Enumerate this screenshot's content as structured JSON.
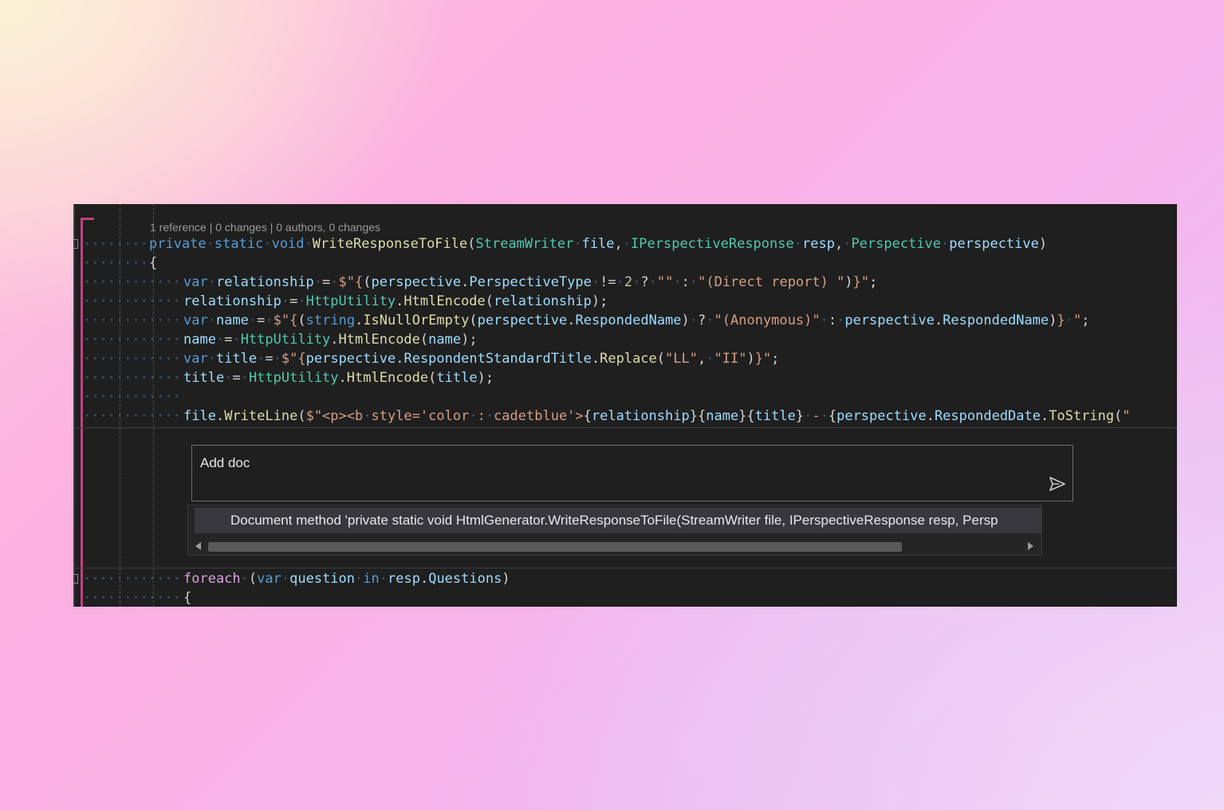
{
  "codelens": "1 reference | 0 changes | 0 authors, 0 changes",
  "code_lines": [
    {
      "tokens": [
        [
          "kw",
          "private"
        ],
        [
          "ws",
          " "
        ],
        [
          "kw",
          "static"
        ],
        [
          "ws",
          " "
        ],
        [
          "kw",
          "void"
        ],
        [
          "ws",
          " "
        ],
        [
          "mt",
          "WriteResponseToFile"
        ],
        [
          "",
          "("
        ],
        [
          "ty",
          "StreamWriter"
        ],
        [
          "ws",
          " "
        ],
        [
          "vr",
          "file"
        ],
        [
          "",
          ","
        ],
        [
          "ws",
          " "
        ],
        [
          "ty",
          "IPerspectiveResponse"
        ],
        [
          "ws",
          " "
        ],
        [
          "vr",
          "resp"
        ],
        [
          "",
          ","
        ],
        [
          "ws",
          " "
        ],
        [
          "ty",
          "Perspective"
        ],
        [
          "ws",
          " "
        ],
        [
          "vr",
          "perspective"
        ],
        [
          "",
          ")"
        ]
      ]
    },
    {
      "tokens": [
        [
          "",
          "{"
        ]
      ]
    },
    {
      "tokens": [
        [
          "kw",
          "var"
        ],
        [
          "ws",
          " "
        ],
        [
          "vr",
          "relationship"
        ],
        [
          "ws",
          " "
        ],
        [
          "",
          "="
        ],
        [
          "ws",
          " "
        ],
        [
          "st",
          "$\"{"
        ],
        [
          "",
          "("
        ],
        [
          "vr",
          "perspective"
        ],
        [
          "",
          "."
        ],
        [
          "vr",
          "PerspectiveType"
        ],
        [
          "ws",
          " "
        ],
        [
          "",
          "!="
        ],
        [
          "ws",
          " "
        ],
        [
          "nm",
          "2"
        ],
        [
          "ws",
          " "
        ],
        [
          "",
          "?"
        ],
        [
          "ws",
          " "
        ],
        [
          "st",
          "\"\""
        ],
        [
          "ws",
          " "
        ],
        [
          "",
          ":"
        ],
        [
          "ws",
          " "
        ],
        [
          "st",
          "\"(Direct report) \""
        ],
        [
          "",
          ")"
        ],
        [
          "st",
          "}\""
        ],
        [
          "",
          ";"
        ]
      ]
    },
    {
      "tokens": [
        [
          "vr",
          "relationship"
        ],
        [
          "ws",
          " "
        ],
        [
          "",
          "="
        ],
        [
          "ws",
          " "
        ],
        [
          "ty",
          "HttpUtility"
        ],
        [
          "",
          "."
        ],
        [
          "mt",
          "HtmlEncode"
        ],
        [
          "",
          "("
        ],
        [
          "vr",
          "relationship"
        ],
        [
          "",
          ");"
        ]
      ]
    },
    {
      "tokens": [
        [
          "kw",
          "var"
        ],
        [
          "ws",
          " "
        ],
        [
          "vr",
          "name"
        ],
        [
          "ws",
          " "
        ],
        [
          "",
          "="
        ],
        [
          "ws",
          " "
        ],
        [
          "st",
          "$\"{"
        ],
        [
          "",
          "("
        ],
        [
          "kw",
          "string"
        ],
        [
          "",
          "."
        ],
        [
          "mt",
          "IsNullOrEmpty"
        ],
        [
          "",
          "("
        ],
        [
          "vr",
          "perspective"
        ],
        [
          "",
          "."
        ],
        [
          "vr",
          "RespondedName"
        ],
        [
          "",
          ")"
        ],
        [
          "ws",
          " "
        ],
        [
          "",
          "?"
        ],
        [
          "ws",
          " "
        ],
        [
          "st",
          "\"(Anonymous)\""
        ],
        [
          "ws",
          " "
        ],
        [
          "",
          ":"
        ],
        [
          "ws",
          " "
        ],
        [
          "vr",
          "perspective"
        ],
        [
          "",
          "."
        ],
        [
          "vr",
          "RespondedName"
        ],
        [
          "",
          ")"
        ],
        [
          "st",
          "}"
        ],
        [
          "ws",
          " "
        ],
        [
          "st",
          "\""
        ],
        [
          "",
          ";"
        ]
      ]
    },
    {
      "tokens": [
        [
          "vr",
          "name"
        ],
        [
          "ws",
          " "
        ],
        [
          "",
          "="
        ],
        [
          "ws",
          " "
        ],
        [
          "ty",
          "HttpUtility"
        ],
        [
          "",
          "."
        ],
        [
          "mt",
          "HtmlEncode"
        ],
        [
          "",
          "("
        ],
        [
          "vr",
          "name"
        ],
        [
          "",
          ");"
        ]
      ]
    },
    {
      "tokens": [
        [
          "kw",
          "var"
        ],
        [
          "ws",
          " "
        ],
        [
          "vr",
          "title"
        ],
        [
          "ws",
          " "
        ],
        [
          "",
          "="
        ],
        [
          "ws",
          " "
        ],
        [
          "st",
          "$\"{"
        ],
        [
          "vr",
          "perspective"
        ],
        [
          "",
          "."
        ],
        [
          "vr",
          "RespondentStandardTitle"
        ],
        [
          "",
          "."
        ],
        [
          "mt",
          "Replace"
        ],
        [
          "",
          "("
        ],
        [
          "st",
          "\"LL\""
        ],
        [
          "",
          ","
        ],
        [
          "ws",
          " "
        ],
        [
          "st",
          "\"II\""
        ],
        [
          "",
          ")"
        ],
        [
          "st",
          "}\""
        ],
        [
          "",
          ";"
        ]
      ]
    },
    {
      "tokens": [
        [
          "vr",
          "title"
        ],
        [
          "ws",
          " "
        ],
        [
          "",
          "="
        ],
        [
          "ws",
          " "
        ],
        [
          "ty",
          "HttpUtility"
        ],
        [
          "",
          "."
        ],
        [
          "mt",
          "HtmlEncode"
        ],
        [
          "",
          "("
        ],
        [
          "vr",
          "title"
        ],
        [
          "",
          ");"
        ]
      ]
    },
    {
      "tokens": []
    },
    {
      "tokens": [
        [
          "vr",
          "file"
        ],
        [
          "",
          "."
        ],
        [
          "mt",
          "WriteLine"
        ],
        [
          "",
          "("
        ],
        [
          "st",
          "$\"<p><b"
        ],
        [
          "ws",
          " "
        ],
        [
          "st",
          "style='color"
        ],
        [
          "ws",
          " "
        ],
        [
          "st",
          ":"
        ],
        [
          "ws",
          " "
        ],
        [
          "st",
          "cadetblue'>"
        ],
        [
          "",
          "{"
        ],
        [
          "vr",
          "relationship"
        ],
        [
          "",
          "}{"
        ],
        [
          "vr",
          "name"
        ],
        [
          "",
          "}{"
        ],
        [
          "vr",
          "title"
        ],
        [
          "",
          "}"
        ],
        [
          "ws",
          " "
        ],
        [
          "st",
          "-"
        ],
        [
          "ws",
          " "
        ],
        [
          "",
          "{"
        ],
        [
          "vr",
          "perspective"
        ],
        [
          "",
          "."
        ],
        [
          "vr",
          "RespondedDate"
        ],
        [
          "",
          "."
        ],
        [
          "mt",
          "ToString"
        ],
        [
          "",
          "("
        ],
        [
          "st",
          "\""
        ]
      ]
    }
  ],
  "lower_lines": [
    {
      "tokens": [
        [
          "kw2",
          "foreach"
        ],
        [
          "ws",
          " "
        ],
        [
          "",
          "("
        ],
        [
          "kw",
          "var"
        ],
        [
          "ws",
          " "
        ],
        [
          "vr",
          "question"
        ],
        [
          "ws",
          " "
        ],
        [
          "kw",
          "in"
        ],
        [
          "ws",
          " "
        ],
        [
          "vr",
          "resp"
        ],
        [
          "",
          "."
        ],
        [
          "vr",
          "Questions"
        ],
        [
          "",
          ")"
        ]
      ]
    },
    {
      "tokens": [
        [
          "",
          "{"
        ]
      ]
    }
  ],
  "chat_input": {
    "value": "Add doc"
  },
  "suggestion": "Document method 'private static void HtmlGenerator.WriteResponseToFile(StreamWriter file, IPerspectiveResponse resp, Persp",
  "icons": {
    "send": "send-icon",
    "scroll_left": "scroll-left-icon",
    "scroll_right": "scroll-right-icon"
  },
  "colors": {
    "keyword": "#569cd6",
    "control": "#d8a0df",
    "type": "#4ec9b0",
    "method": "#dcdcaa",
    "variable": "#9cdcfe",
    "string": "#d69d85",
    "number": "#b5cea8",
    "editor_bg": "#1f1f1f"
  }
}
